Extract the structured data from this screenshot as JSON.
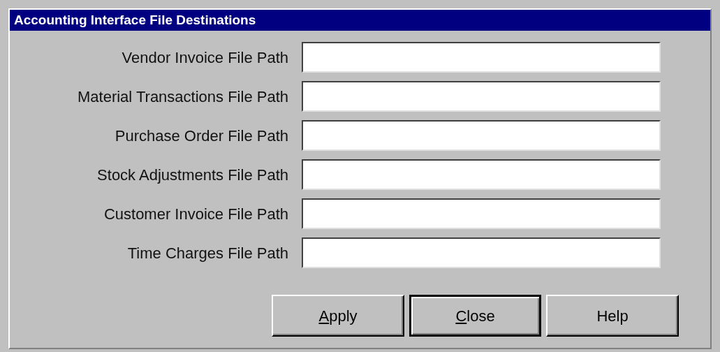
{
  "window": {
    "title": "Accounting Interface File Destinations"
  },
  "fields": [
    {
      "label": "Vendor Invoice File Path"
    },
    {
      "label": "Material Transactions File Path"
    },
    {
      "label": "Purchase Order File Path"
    },
    {
      "label": "Stock Adjustments File Path"
    },
    {
      "label": "Customer Invoice File Path"
    },
    {
      "label": "Time Charges File Path"
    }
  ],
  "buttons": [
    {
      "label": "Apply",
      "underline_first": true,
      "default": false
    },
    {
      "label": "Close",
      "underline_first": true,
      "default": true
    },
    {
      "label": "Help",
      "underline_first": false,
      "default": false
    }
  ]
}
